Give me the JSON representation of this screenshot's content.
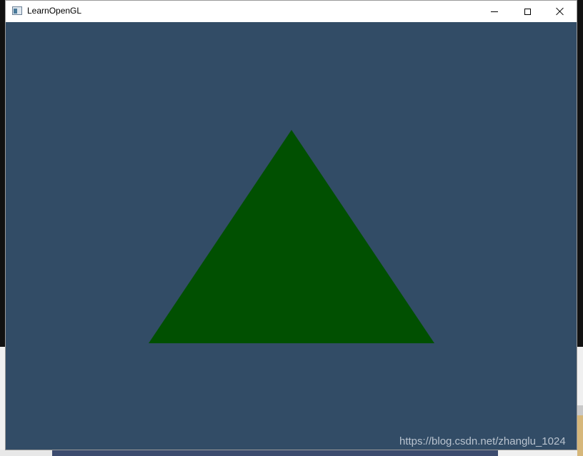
{
  "window": {
    "title": "LearnOpenGL",
    "app_icon": "window-app-icon",
    "controls": {
      "minimize_icon": "minimize-icon",
      "maximize_icon": "maximize-icon",
      "close_icon": "close-icon"
    }
  },
  "scene": {
    "clear_color": "#324c66",
    "triangle_color": "#015001"
  },
  "watermark": {
    "text": "https://blog.csdn.net/zhanglu_1024"
  }
}
